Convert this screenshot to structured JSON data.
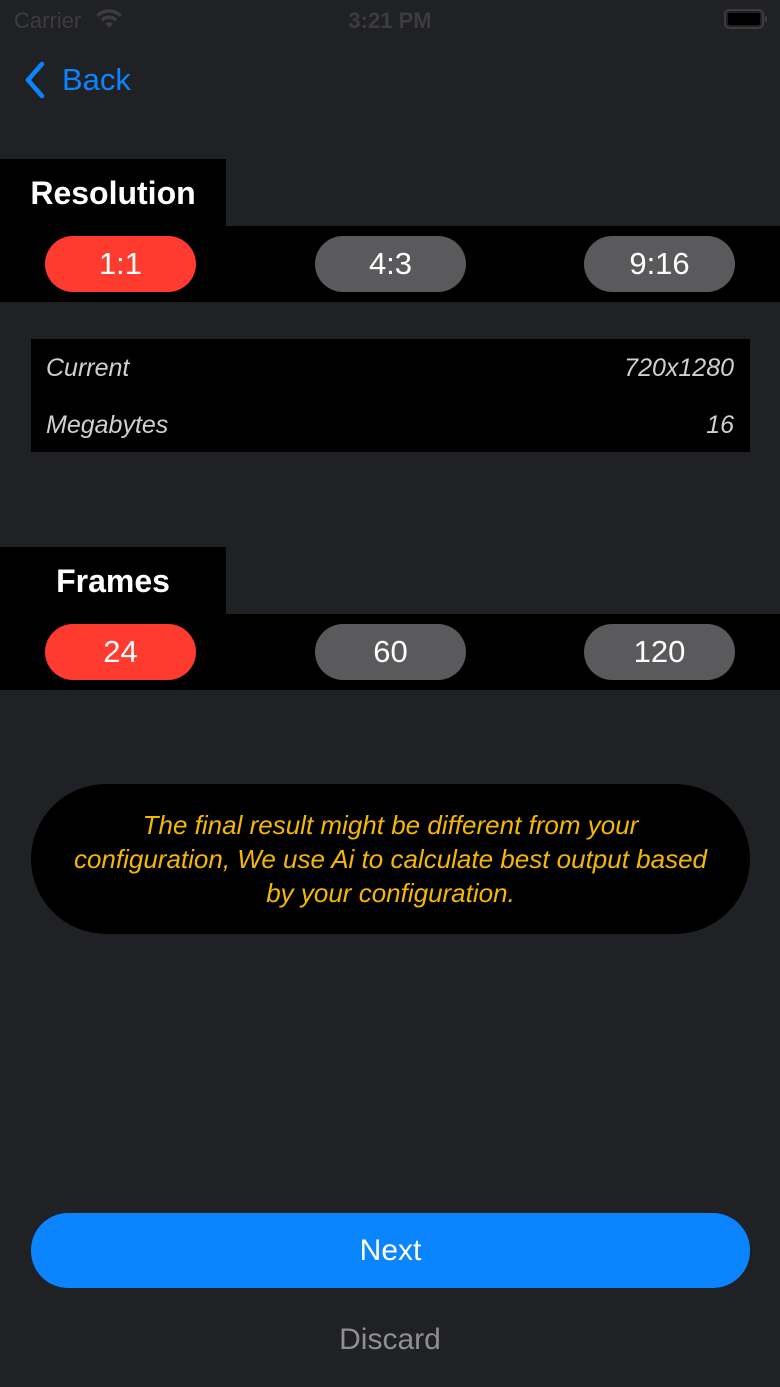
{
  "status_bar": {
    "carrier": "Carrier",
    "time": "3:21 PM",
    "icons": [
      "wifi-icon",
      "battery-icon"
    ]
  },
  "nav": {
    "back_label": "Back",
    "back_icon": "chevron-left-icon"
  },
  "resolution": {
    "title": "Resolution",
    "options": [
      "1:1",
      "4:3",
      "9:16"
    ],
    "selected": "1:1"
  },
  "info": {
    "rows": [
      {
        "label": "Current",
        "value": "720x1280"
      },
      {
        "label": "Megabytes",
        "value": "16"
      }
    ]
  },
  "frames": {
    "title": "Frames",
    "options": [
      "24",
      "60",
      "120"
    ],
    "selected": "24"
  },
  "notice": {
    "text": "The final result might be different from your configuration, We use Ai to calculate best output based by your configuration."
  },
  "actions": {
    "next_label": "Next",
    "discard_label": "Discard"
  },
  "colors": {
    "background": "#202124",
    "selected_pill": "#ff3b30",
    "unselected_pill": "#5a5a5c",
    "accent": "#0a84ff",
    "notice_text": "#f5b800"
  }
}
